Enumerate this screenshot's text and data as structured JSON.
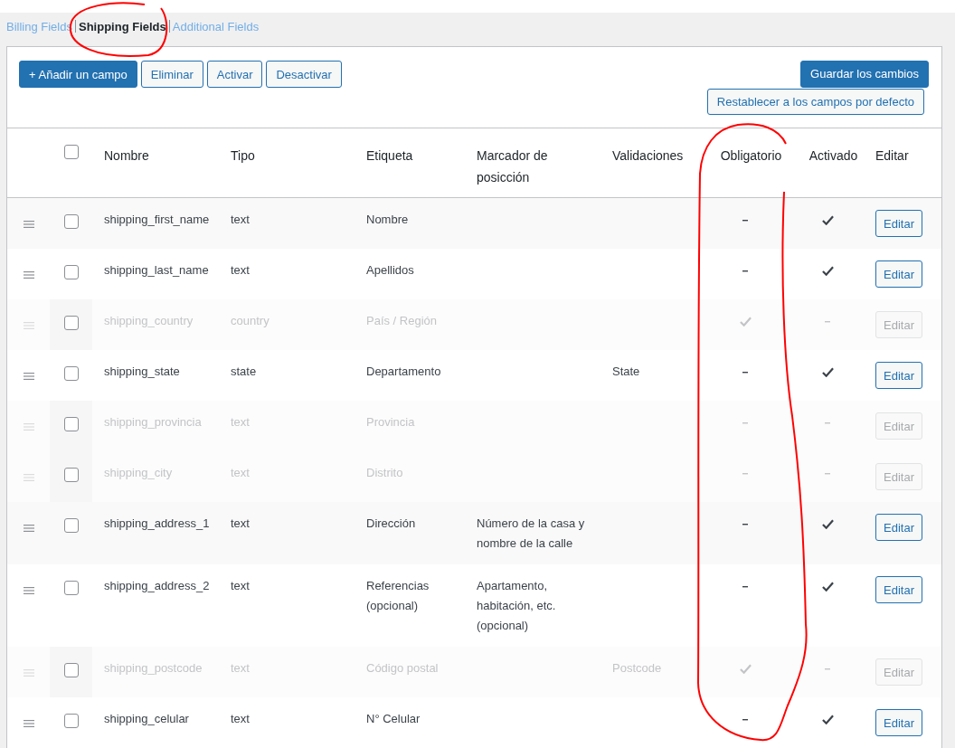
{
  "tabs": [
    {
      "label": "Billing Fields",
      "selected": false,
      "circled": false
    },
    {
      "label": "Shipping Fields",
      "selected": true,
      "circled": true
    },
    {
      "label": "Additional Fields",
      "selected": false,
      "circled": false
    }
  ],
  "toolbar": {
    "left_buttons": [
      {
        "label": "+ Añadir un campo",
        "kind": "primary"
      },
      {
        "label": "Eliminar",
        "kind": "secondary"
      },
      {
        "label": "Activar",
        "kind": "secondary"
      },
      {
        "label": "Desactivar",
        "kind": "secondary"
      }
    ],
    "right_buttons": [
      {
        "label": "Guardar los cambios",
        "kind": "primary"
      },
      {
        "label": "Restablecer a los campos por defecto",
        "kind": "secondary"
      }
    ]
  },
  "table": {
    "select_all_checked": false,
    "columns": [
      {
        "label": "Nombre",
        "circled": false
      },
      {
        "label": "Tipo",
        "circled": false
      },
      {
        "label": "Etiqueta",
        "circled": false
      },
      {
        "label": "Marcador de posicción",
        "circled": false
      },
      {
        "label": "Validaciones",
        "circled": false
      },
      {
        "label": "Obligatorio",
        "circled": true
      },
      {
        "label": "Activado",
        "circled": false
      },
      {
        "label": "Editar",
        "circled": false
      }
    ],
    "rows": [
      {
        "name": "shipping_first_name",
        "type": "text",
        "label": "Nombre",
        "placeholder": "",
        "validation": "",
        "required": false,
        "enabled": true,
        "edit": "Editar"
      },
      {
        "name": "shipping_last_name",
        "type": "text",
        "label": "Apellidos",
        "placeholder": "",
        "validation": "",
        "required": false,
        "enabled": true,
        "edit": "Editar"
      },
      {
        "name": "shipping_country",
        "type": "country",
        "label": "País / Región",
        "placeholder": "",
        "validation": "",
        "required": true,
        "enabled": false,
        "edit": "Editar"
      },
      {
        "name": "shipping_state",
        "type": "state",
        "label": "Departamento",
        "placeholder": "",
        "validation": "State",
        "required": false,
        "enabled": true,
        "edit": "Editar"
      },
      {
        "name": "shipping_provincia",
        "type": "text",
        "label": "Provincia",
        "placeholder": "",
        "validation": "",
        "required": false,
        "enabled": false,
        "edit": "Editar"
      },
      {
        "name": "shipping_city",
        "type": "text",
        "label": "Distrito",
        "placeholder": "",
        "validation": "",
        "required": false,
        "enabled": false,
        "edit": "Editar"
      },
      {
        "name": "shipping_address_1",
        "type": "text",
        "label": "Dirección",
        "placeholder": "Número de la casa y nombre de la calle",
        "validation": "",
        "required": false,
        "enabled": true,
        "edit": "Editar"
      },
      {
        "name": "shipping_address_2",
        "type": "text",
        "label": "Referencias (opcional)",
        "placeholder": "Apartamento, habitación, etc. (opcional)",
        "validation": "",
        "required": false,
        "enabled": true,
        "edit": "Editar"
      },
      {
        "name": "shipping_postcode",
        "type": "text",
        "label": "Código postal",
        "placeholder": "",
        "validation": "Postcode",
        "required": true,
        "enabled": false,
        "edit": "Editar"
      },
      {
        "name": "shipping_celular",
        "type": "text",
        "label": "N° Celular",
        "placeholder": "",
        "validation": "",
        "required": false,
        "enabled": true,
        "edit": "Editar"
      }
    ]
  }
}
